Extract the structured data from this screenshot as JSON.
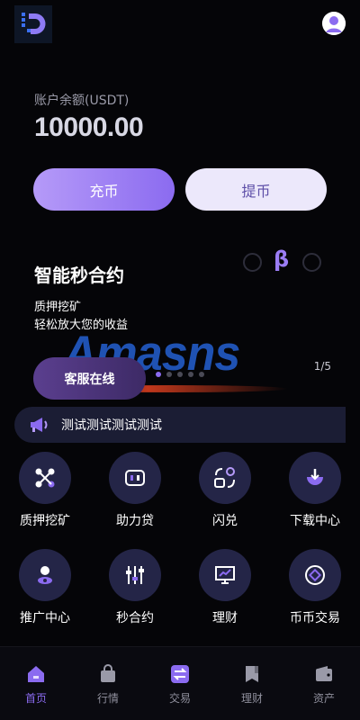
{
  "header": {
    "logo_icon": "d-logo-icon",
    "avatar_icon": "user-avatar-icon"
  },
  "balance": {
    "label": "账户余额(USDT)",
    "value": "10000.00"
  },
  "actions": {
    "deposit_label": "充币",
    "withdraw_label": "提币"
  },
  "banner": {
    "title": "智能秒合约",
    "subtitle_1": "质押挖矿",
    "subtitle_2": "轻松放大您的收益",
    "service_button": "客服在线",
    "watermark": "Amasns",
    "coin_symbol": "β",
    "pager": "1/5",
    "active_slide": 1,
    "slide_count": 5
  },
  "notice": {
    "icon": "megaphone-icon",
    "text": "测试测试测试测试"
  },
  "grid": [
    {
      "label": "质押挖矿",
      "icon": "nodes-icon"
    },
    {
      "label": "助力贷",
      "icon": "wallet-card-icon"
    },
    {
      "label": "闪兑",
      "icon": "exchange-icon"
    },
    {
      "label": "下载中心",
      "icon": "download-icon"
    },
    {
      "label": "推广中心",
      "icon": "user-pin-icon"
    },
    {
      "label": "秒合约",
      "icon": "sliders-icon"
    },
    {
      "label": "理财",
      "icon": "chart-board-icon"
    },
    {
      "label": "币币交易",
      "icon": "coin-icon"
    }
  ],
  "tabs": [
    {
      "label": "首页",
      "icon": "home-icon",
      "active": true
    },
    {
      "label": "行情",
      "icon": "bag-icon",
      "active": false
    },
    {
      "label": "交易",
      "icon": "swap-icon",
      "active": false
    },
    {
      "label": "理财",
      "icon": "book-icon",
      "active": false
    },
    {
      "label": "资产",
      "icon": "wallet-icon",
      "active": false
    }
  ],
  "colors": {
    "accent": "#8b6bf0",
    "background": "#050508",
    "icon_circle": "#242547"
  }
}
